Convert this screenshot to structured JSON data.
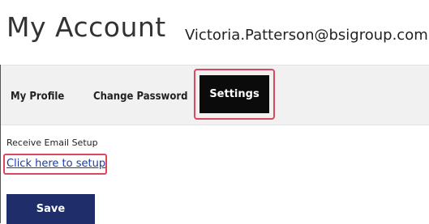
{
  "header": {
    "title": "My Account",
    "email": "Victoria.Patterson@bsigroup.com"
  },
  "tabs": [
    {
      "label": "My Profile",
      "active": false
    },
    {
      "label": "Change Password",
      "active": false
    },
    {
      "label": "Settings",
      "active": true
    }
  ],
  "settings": {
    "email_setup_label": "Receive Email Setup",
    "setup_link": "Click here to setup",
    "save_label": "Save"
  },
  "colors": {
    "active_tab_bg": "#0b0b0b",
    "highlight_outline": "#d9485f",
    "link": "#1a3ba6",
    "save_button_bg": "#1f2d6b"
  }
}
